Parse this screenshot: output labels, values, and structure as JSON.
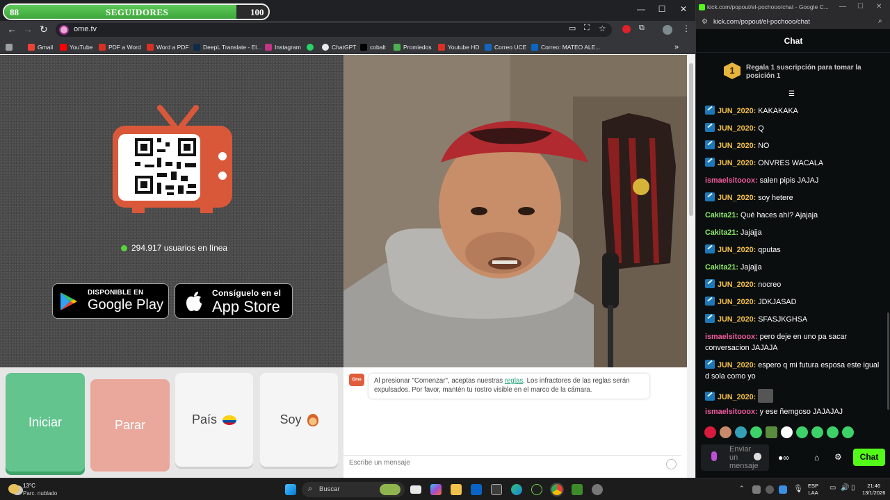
{
  "followers": {
    "current": "88",
    "label": "SEGUIDORES",
    "goal": "100",
    "progress": 0.88
  },
  "browser": {
    "url": "ome.tv",
    "bookmarks": [
      "Gmail",
      "YouTube",
      "PDF a Word",
      "Word a PDF",
      "DeepL Translate - El...",
      "Instagram",
      "ChatGPT",
      "cobalt",
      "Promiedos",
      "Youtube HD",
      "Correo UCE",
      "Correo: MATEO ALE..."
    ],
    "bookmark_colors": [
      "#ea4335",
      "#ff0000",
      "#d93025",
      "#d93025",
      "#0f2b46",
      "#c13584",
      "#25d366",
      "#e8eaed",
      "#000000",
      "#4caf50",
      "#d93025",
      "#1565c0",
      "#0a66c2"
    ]
  },
  "ome": {
    "online_text": "294.917 usuarios en línea",
    "google_play_small": "DISPONIBLE EN",
    "google_play_big": "Google Play",
    "app_store_small": "Consíguelo en el",
    "app_store_big": "App Store",
    "start_label": "Iniciar",
    "stop_label": "Parar",
    "country_label": "País",
    "gender_label": "Soy",
    "notice_prefix": "Al presionar \"Comenzar\", aceptas nuestras ",
    "notice_link": "reglas",
    "notice_suffix": ". Los infractores de las reglas serán expulsados. Por favor, mantén tu rostro visible en el marco de la cámara.",
    "message_placeholder": "Escribe un mensaje",
    "logo_text": "Ome"
  },
  "kick": {
    "tab_title": "kick.com/popout/el-pochooo/chat - Google C...",
    "url": "kick.com/popout/el-pochooo/chat",
    "header": "Chat",
    "promo_badge": "1",
    "promo_text": "Regala 1 suscripción para tomar la posición 1",
    "messages": [
      {
        "user": "JUN_2020",
        "text": "KAKAKAKA",
        "color": "#f5c24a",
        "badge": true
      },
      {
        "user": "JUN_2020",
        "text": "Q",
        "color": "#f5c24a",
        "badge": true
      },
      {
        "user": "JUN_2020",
        "text": "NO",
        "color": "#f5c24a",
        "badge": true
      },
      {
        "user": "JUN_2020",
        "text": "ONVRES WACALA",
        "color": "#f5c24a",
        "badge": true
      },
      {
        "user": "ismaelsitooox",
        "text": "salen pipis JAJAJ",
        "color": "#f05aa0",
        "badge": false
      },
      {
        "user": "JUN_2020",
        "text": "soy hetere",
        "color": "#f5c24a",
        "badge": true
      },
      {
        "user": "Cakita21",
        "text": "Qué haces ahí? Ajajaja",
        "color": "#8ff06a",
        "badge": false
      },
      {
        "user": "Cakita21",
        "text": "Jajajja",
        "color": "#8ff06a",
        "badge": false
      },
      {
        "user": "JUN_2020",
        "text": "qputas",
        "color": "#f5c24a",
        "badge": true
      },
      {
        "user": "Cakita21",
        "text": "Jajajja",
        "color": "#8ff06a",
        "badge": false
      },
      {
        "user": "JUN_2020",
        "text": "nocreo",
        "color": "#f5c24a",
        "badge": true
      },
      {
        "user": "JUN_2020",
        "text": "JDKJASAD",
        "color": "#f5c24a",
        "badge": true
      },
      {
        "user": "JUN_2020",
        "text": "SFASJKGHSA",
        "color": "#f5c24a",
        "badge": true
      },
      {
        "user": "ismaelsitooox",
        "text": "pero deje en uno pa sacar conversacion JAJAJA",
        "color": "#f05aa0",
        "badge": false
      },
      {
        "user": "JUN_2020",
        "text": "espero q mi futura esposa este igual d sola como yo",
        "color": "#f5c24a",
        "badge": true
      },
      {
        "user": "JUN_2020",
        "text": "",
        "color": "#f5c24a",
        "badge": true,
        "emote": true
      },
      {
        "user": "ismaelsitooox",
        "text": "y ese ñemgoso JAJAJAJ",
        "color": "#f05aa0",
        "badge": false
      }
    ],
    "input_placeholder": "Enviar un mensaje",
    "send_label": "Chat"
  },
  "taskbar": {
    "temperature": "13°C",
    "weather": "Parc. nublado",
    "search_label": "Buscar",
    "lang_top": "ESP",
    "lang_bottom": "LAA",
    "time": "21:46",
    "date": "13/1/2026"
  }
}
